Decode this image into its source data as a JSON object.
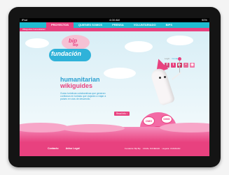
{
  "status_bar": {
    "carrier": "iPad",
    "time": "4:00 AM",
    "battery": "90%"
  },
  "top_nav": {
    "items": [
      {
        "label": "PROYECTOS",
        "active": true
      },
      {
        "label": "QUIENES SOMOS",
        "active": false
      },
      {
        "label": "PRENSA",
        "active": false
      },
      {
        "label": "VOLUNTARIADO",
        "active": false
      },
      {
        "label": "BIPS",
        "active": false
      }
    ]
  },
  "sub_nav": {
    "items": [
      "Wikiguides humanitarian"
    ]
  },
  "logo": {
    "main_text": "fundación",
    "bubble_text": "bip",
    "bubble_text_2": "bip"
  },
  "social": {
    "labels": [
      "Login",
      "Contacto"
    ],
    "icons": [
      "facebook-icon",
      "twitter-icon",
      "youtube-icon",
      "flickr-icon",
      "rss-icon"
    ]
  },
  "hero": {
    "headline_line1": "humanitarian",
    "headline_line2": "wikiguides",
    "description": "Guías turísticas colaborativas que generan confianza en turistas que viajarán a viajar a países en vías de desarrollo.",
    "cta": "Read Info ›",
    "bubbles": [
      "OMG",
      "OMG",
      "OMG"
    ]
  },
  "footer": {
    "links": [
      "Contacto",
      "Aviso Legal"
    ],
    "credits": [
      "Fundación Bip Bip",
      "CANAL SOCIEDAD",
      "Llegada: CIUDADAD"
    ]
  },
  "colors": {
    "cyan": "#20bcd0",
    "pink": "#e8417f",
    "light_pink": "#f36aa5",
    "blue_text": "#2a9fd0"
  }
}
